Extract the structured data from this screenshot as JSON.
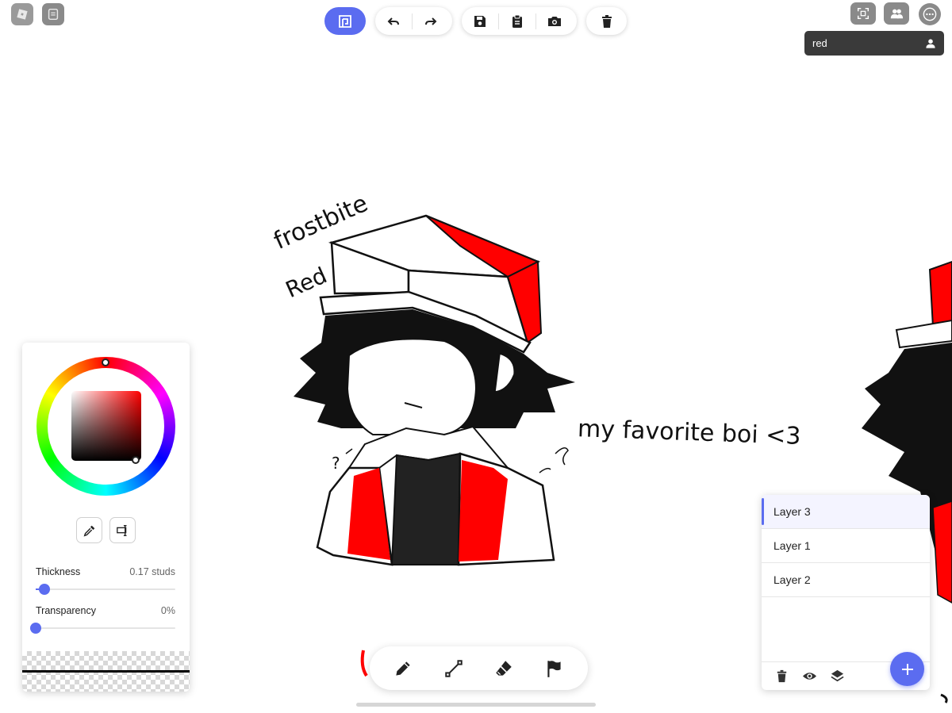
{
  "app": {
    "top_left_icons": [
      "app-logo-icon",
      "notes-icon"
    ]
  },
  "toolbar": {
    "primary_icon": "canvas-mode-icon",
    "groups": [
      [
        "undo-icon",
        "redo-icon"
      ],
      [
        "save-icon",
        "clipboard-icon",
        "camera-icon"
      ],
      [
        "trash-icon"
      ]
    ]
  },
  "top_right": {
    "icons": [
      "fullscreen-icon",
      "players-icon",
      "more-icon"
    ],
    "user_card": {
      "name": "red",
      "icon": "person-icon"
    }
  },
  "canvas_text": {
    "note_1": "frostbite",
    "note_2": "Red",
    "note_3": "my favorite boi <3",
    "note_4": "?"
  },
  "color_panel": {
    "selected_color": "#ff0000",
    "hue_wheel": "conic",
    "tools": [
      "eyedropper-icon",
      "color-replace-icon"
    ],
    "thickness": {
      "label": "Thickness",
      "value": "0.17 studs",
      "fraction": 0.06
    },
    "transparency": {
      "label": "Transparency",
      "value": "0%",
      "fraction": 0.0
    }
  },
  "bottom_tools": [
    {
      "name": "pencil",
      "icon": "pencil-icon"
    },
    {
      "name": "line",
      "icon": "line-tool-icon"
    },
    {
      "name": "eraser",
      "icon": "eraser-icon"
    },
    {
      "name": "flag",
      "icon": "flag-icon"
    }
  ],
  "layers": {
    "items": [
      {
        "label": "Layer 3",
        "active": true
      },
      {
        "label": "Layer 1",
        "active": false
      },
      {
        "label": "Layer 2",
        "active": false
      }
    ],
    "footer_icons": [
      "trash-icon",
      "eye-icon",
      "layers-icon"
    ],
    "add_icon": "plus-icon"
  },
  "colors": {
    "accent": "#5b6cf0",
    "brush_red": "#ff0000",
    "ink": "#111111",
    "user_card_bg": "#3a3a3a"
  }
}
